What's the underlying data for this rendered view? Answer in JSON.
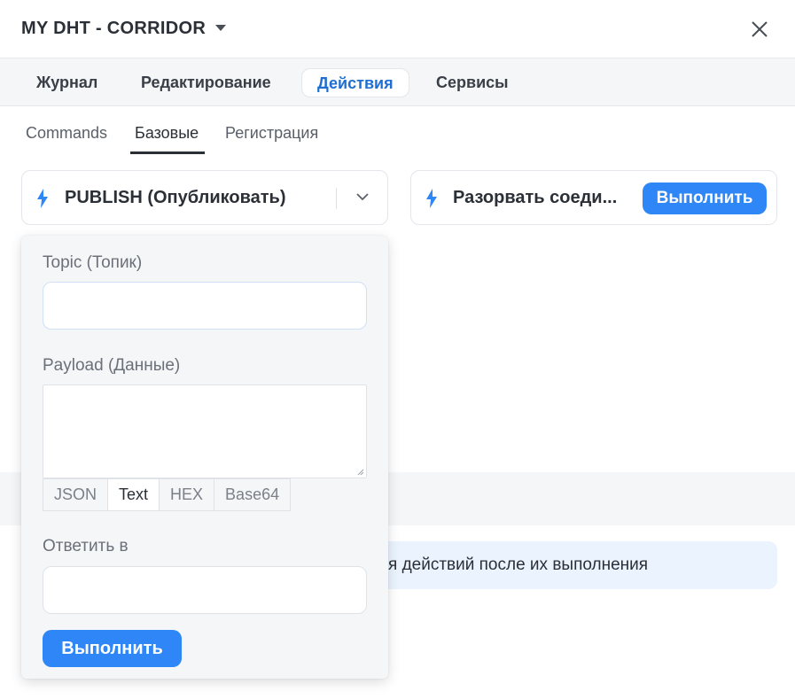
{
  "header": {
    "title": "MY DHT - CORRIDOR"
  },
  "tabs": [
    {
      "label": "Журнал",
      "active": false
    },
    {
      "label": "Редактирование",
      "active": false
    },
    {
      "label": "Действия",
      "active": true
    },
    {
      "label": "Сервисы",
      "active": false
    }
  ],
  "subtabs": [
    {
      "label": "Commands",
      "active": false
    },
    {
      "label": "Базовые",
      "active": true
    },
    {
      "label": "Регистрация",
      "active": false
    }
  ],
  "action_select": {
    "value": "PUBLISH (Опубликовать)",
    "icon": "bolt-icon"
  },
  "action_card_2": {
    "label": "Разорвать соеди...",
    "button_label": "Выполнить",
    "icon": "bolt-icon"
  },
  "publish_form": {
    "topic_label": "Topic (Топик)",
    "topic_value": "",
    "payload_label": "Payload (Данные)",
    "payload_value": "",
    "formats": [
      "JSON",
      "Text",
      "HEX",
      "Base64"
    ],
    "selected_format": "Text",
    "reply_label": "Ответить в",
    "reply_value": "",
    "submit_label": "Выполнить"
  },
  "info_banner": {
    "text": "я действий после их выполнения"
  },
  "colors": {
    "accent": "#2f86f6",
    "active_tab_text": "#1f6fd1",
    "panel_bg": "#f4f6f8",
    "banner_bg": "#eaf3fe"
  }
}
